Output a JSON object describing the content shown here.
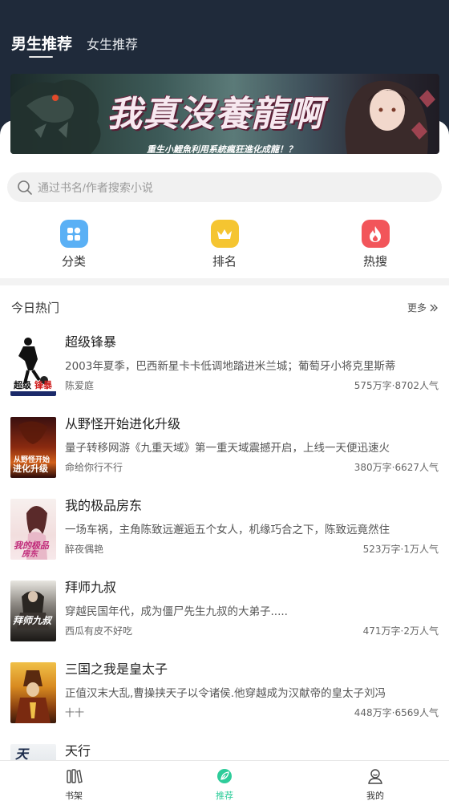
{
  "header": {
    "tabs": [
      {
        "label": "男生推荐",
        "active": true
      },
      {
        "label": "女生推荐",
        "active": false
      }
    ]
  },
  "banner": {
    "title": "我真沒養龍啊",
    "subtitle": "重生小鯉魚利用系統瘋狂進化成龍！？"
  },
  "search": {
    "placeholder": "通过书名/作者搜索小说",
    "icon": "search-icon"
  },
  "categories": [
    {
      "label": "分类",
      "icon": "grid-icon",
      "color": "#5ab0f5"
    },
    {
      "label": "排名",
      "icon": "crown-icon",
      "color": "#f5c531"
    },
    {
      "label": "热搜",
      "icon": "flame-icon",
      "color": "#f2555a"
    }
  ],
  "section": {
    "title": "今日热门",
    "more_label": "更多"
  },
  "books": [
    {
      "title": "超级锋暴",
      "desc": "2003年夏季，巴西新星卡卡低调地踏进米兰城；葡萄牙小将克里斯蒂",
      "author": "陈爱庭",
      "stats": "575万字·8702人气",
      "cover_text": "超级锋暴"
    },
    {
      "title": "从野怪开始进化升级",
      "desc": "量子转移网游《九重天域》第一重天域震撼开启，上线一天便迅速火",
      "author": "命给你行不行",
      "stats": "380万字·6627人气",
      "cover_text": "从野怪开始进化升级"
    },
    {
      "title": "我的极品房东",
      "desc": "一场车祸，主角陈致远邂逅五个女人，机缘巧合之下，陈致远竟然住",
      "author": "醉夜偶艳",
      "stats": "523万字·1万人气",
      "cover_text": "我的极品房东"
    },
    {
      "title": "拜师九叔",
      "desc": "穿越民国年代，成为僵尸先生九叔的大弟子.....",
      "author": "西瓜有皮不好吃",
      "stats": "471万字·2万人气",
      "cover_text": "拜师九叔"
    },
    {
      "title": "三国之我是皇太子",
      "desc": "正值汉末大乱,曹操挟天子以令诸侯.他穿越成为汉献帝的皇太子刘冯",
      "author": "十十",
      "stats": "448万字·6569人气",
      "cover_text": ""
    },
    {
      "title": "天行",
      "desc": "",
      "author": "",
      "stats": "",
      "cover_text": "天"
    }
  ],
  "bottom_nav": [
    {
      "label": "书架",
      "icon": "bookshelf-icon",
      "active": false
    },
    {
      "label": "推荐",
      "icon": "leaf-icon",
      "active": true
    },
    {
      "label": "我的",
      "icon": "profile-icon",
      "active": false
    }
  ],
  "colors": {
    "header_bg": "#1f2a3a",
    "accent": "#2ecc9a"
  }
}
